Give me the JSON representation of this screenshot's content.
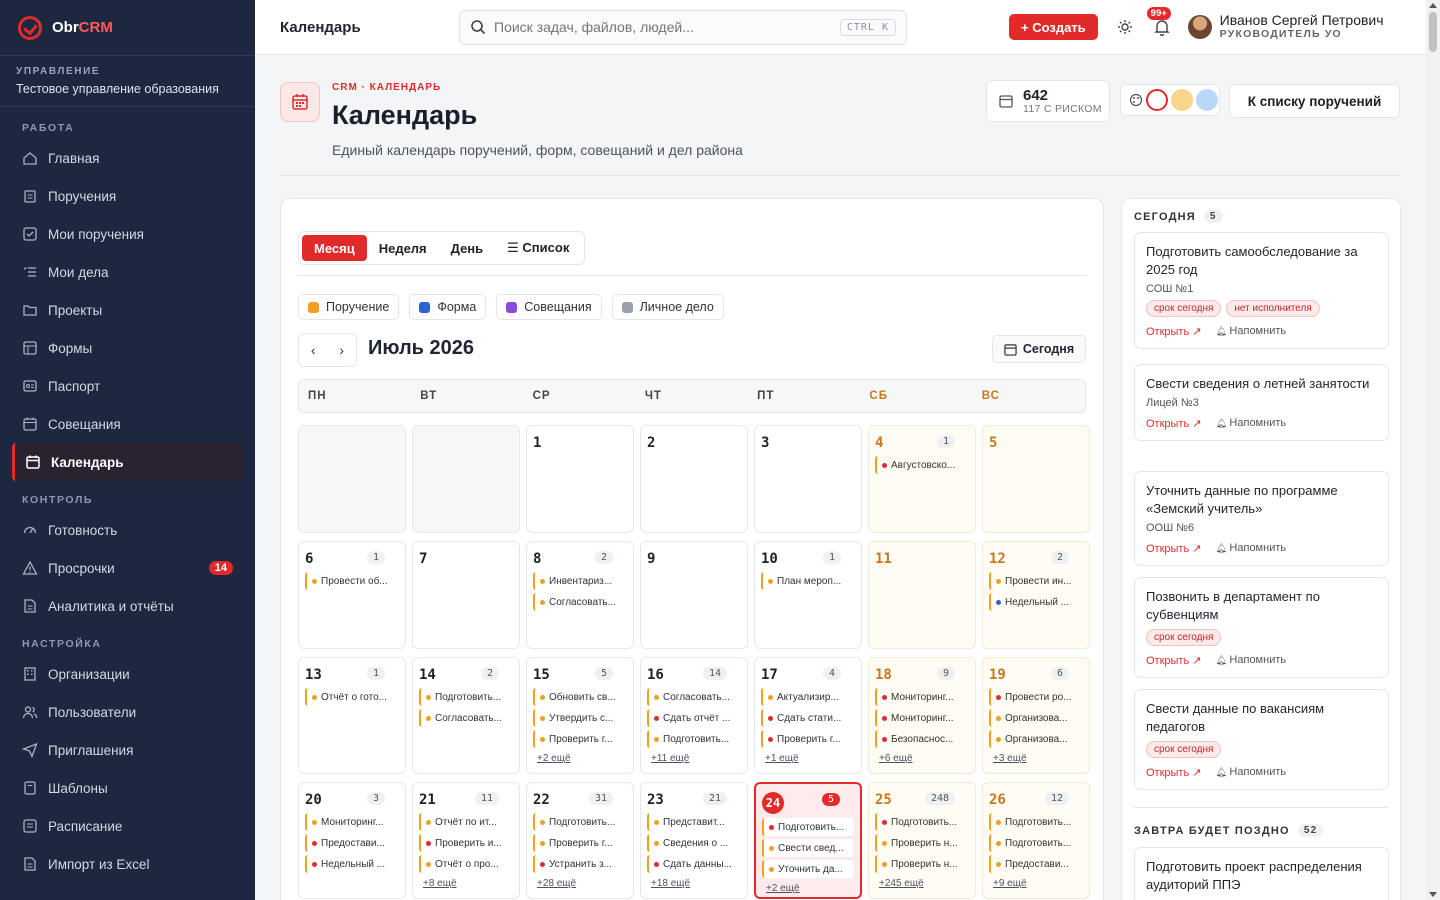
{
  "brand": {
    "name_a": "Obr",
    "name_b": "CRM"
  },
  "org": {
    "caption": "УПРАВЛЕНИЕ",
    "name": "Тестовое управление образования"
  },
  "sidebar": {
    "sections": [
      {
        "title": "РАБОТА",
        "items": [
          {
            "label": "Главная",
            "icon": "home-icon"
          },
          {
            "label": "Поручения",
            "icon": "clipboard-icon"
          },
          {
            "label": "Мои поручения",
            "icon": "check-square-icon"
          },
          {
            "label": "Мои дела",
            "icon": "list-check-icon"
          },
          {
            "label": "Проекты",
            "icon": "folder-icon"
          },
          {
            "label": "Формы",
            "icon": "form-icon"
          },
          {
            "label": "Паспорт",
            "icon": "id-card-icon"
          },
          {
            "label": "Совещания",
            "icon": "calendar-meeting-icon"
          },
          {
            "label": "Календарь",
            "icon": "calendar-icon",
            "active": true
          }
        ]
      },
      {
        "title": "КОНТРОЛЬ",
        "items": [
          {
            "label": "Готовность",
            "icon": "gauge-icon"
          },
          {
            "label": "Просрочки",
            "icon": "warning-icon",
            "badge": "14"
          },
          {
            "label": "Аналитика и отчёты",
            "icon": "report-icon"
          }
        ]
      },
      {
        "title": "НАСТРОЙКА",
        "items": [
          {
            "label": "Организации",
            "icon": "building-icon"
          },
          {
            "label": "Пользователи",
            "icon": "users-icon"
          },
          {
            "label": "Приглашения",
            "icon": "send-icon"
          },
          {
            "label": "Шаблоны",
            "icon": "template-icon"
          },
          {
            "label": "Расписание",
            "icon": "clock-icon"
          },
          {
            "label": "Импорт из Excel",
            "icon": "file-icon"
          }
        ]
      }
    ]
  },
  "topbar": {
    "title": "Календарь",
    "search_placeholder": "Поиск задач, файлов, людей...",
    "search_kbd": "CTRL K",
    "create_label": "+ Создать",
    "notif_badge": "99+",
    "user_name": "Иванов Сергей Петрович",
    "user_role": "РУКОВОДИТЕЛЬ УО"
  },
  "header": {
    "crumb": "CRM · КАЛЕНДАРЬ",
    "title": "Календарь",
    "subtitle": "Единый календарь поручений, форм, совещаний и дел района",
    "stat_value": "642",
    "stat_sub": "117 С РИСКОМ",
    "back_label": "К списку поручений",
    "theme_colors": [
      "#ffffff",
      "#f9d48b",
      "#b9d7f7"
    ]
  },
  "calendar": {
    "views": [
      "Месяц",
      "Неделя",
      "День",
      "☰ Список"
    ],
    "legend": [
      {
        "label": "Поручение",
        "color": "#f0a020"
      },
      {
        "label": "Форма",
        "color": "#2b62d9"
      },
      {
        "label": "Совещания",
        "color": "#8b4ae0"
      },
      {
        "label": "Личное дело",
        "color": "#9aa0aa"
      }
    ],
    "month_label": "Июль 2026",
    "today_label": "Сегодня",
    "weekdays": [
      "ПН",
      "ВТ",
      "СР",
      "ЧТ",
      "ПТ",
      "СБ",
      "ВС"
    ],
    "weeks": [
      [
        {
          "empty": true
        },
        {
          "empty": true
        },
        {
          "day": "1",
          "events": []
        },
        {
          "day": "2",
          "events": []
        },
        {
          "day": "3",
          "events": []
        },
        {
          "day": "4",
          "count": "1",
          "events": [
            {
              "t": "Августовско...",
              "c": "#e32a2a"
            }
          ]
        },
        {
          "day": "5",
          "events": []
        }
      ],
      [
        {
          "day": "6",
          "count": "1",
          "events": [
            {
              "t": "Провести об...",
              "c": "#f0a020"
            }
          ]
        },
        {
          "day": "7",
          "events": []
        },
        {
          "day": "8",
          "count": "2",
          "events": [
            {
              "t": "Инвентариз...",
              "c": "#f0a020"
            },
            {
              "t": "Согласовать...",
              "c": "#f0a020"
            }
          ]
        },
        {
          "day": "9",
          "events": []
        },
        {
          "day": "10",
          "count": "1",
          "events": [
            {
              "t": "План мероп...",
              "c": "#f0a020"
            }
          ]
        },
        {
          "day": "11",
          "events": []
        },
        {
          "day": "12",
          "count": "2",
          "events": [
            {
              "t": "Провести ин...",
              "c": "#f0a020"
            },
            {
              "t": "Недельный ...",
              "c": "#2b62d9"
            }
          ]
        }
      ],
      [
        {
          "day": "13",
          "count": "1",
          "events": [
            {
              "t": "Отчёт о гото...",
              "c": "#f0a020"
            }
          ]
        },
        {
          "day": "14",
          "count": "2",
          "events": [
            {
              "t": "Подготовить...",
              "c": "#f0a020"
            },
            {
              "t": "Согласовать...",
              "c": "#f0a020"
            }
          ]
        },
        {
          "day": "15",
          "count": "5",
          "events": [
            {
              "t": "Обновить св...",
              "c": "#f0a020"
            },
            {
              "t": "Утвердить с...",
              "c": "#f0a020"
            },
            {
              "t": "Проверить г...",
              "c": "#f0a020"
            }
          ],
          "more": "+2 ещё"
        },
        {
          "day": "16",
          "count": "14",
          "events": [
            {
              "t": "Согласовать...",
              "c": "#f0a020"
            },
            {
              "t": "Сдать отчёт ...",
              "c": "#e32a2a"
            },
            {
              "t": "Подготовить...",
              "c": "#f0a020"
            }
          ],
          "more": "+11 ещё"
        },
        {
          "day": "17",
          "count": "4",
          "events": [
            {
              "t": "Актуализир...",
              "c": "#f0a020"
            },
            {
              "t": "Сдать стати...",
              "c": "#e32a2a"
            },
            {
              "t": "Проверить г...",
              "c": "#e32a2a"
            }
          ],
          "more": "+1 ещё"
        },
        {
          "day": "18",
          "count": "9",
          "events": [
            {
              "t": "Мониторинг...",
              "c": "#e32a2a"
            },
            {
              "t": "Мониторинг...",
              "c": "#e32a2a"
            },
            {
              "t": "Безопаснос...",
              "c": "#e32a2a"
            }
          ],
          "more": "+6 ещё"
        },
        {
          "day": "19",
          "count": "6",
          "events": [
            {
              "t": "Провести ро...",
              "c": "#e32a2a"
            },
            {
              "t": "Организова...",
              "c": "#f0a020"
            },
            {
              "t": "Организова...",
              "c": "#f0a020"
            }
          ],
          "more": "+3 ещё"
        }
      ],
      [
        {
          "day": "20",
          "count": "3",
          "events": [
            {
              "t": "Мониторинг...",
              "c": "#f0a020"
            },
            {
              "t": "Предостави...",
              "c": "#e32a2a"
            },
            {
              "t": "Недельный ...",
              "c": "#e32a2a"
            }
          ]
        },
        {
          "day": "21",
          "count": "11",
          "events": [
            {
              "t": "Отчёт по ит...",
              "c": "#f0a020"
            },
            {
              "t": "Проверить и...",
              "c": "#e32a2a"
            },
            {
              "t": "Отчёт о про...",
              "c": "#f0a020"
            }
          ],
          "more": "+8 ещё"
        },
        {
          "day": "22",
          "count": "31",
          "events": [
            {
              "t": "Подготовить...",
              "c": "#f0a020"
            },
            {
              "t": "Проверить г...",
              "c": "#f0a020"
            },
            {
              "t": "Устранить з...",
              "c": "#e32a2a"
            }
          ],
          "more": "+28 ещё"
        },
        {
          "day": "23",
          "count": "21",
          "events": [
            {
              "t": "Представит...",
              "c": "#f0a020"
            },
            {
              "t": "Сведения о ...",
              "c": "#f0a020"
            },
            {
              "t": "Сдать данны...",
              "c": "#e32a2a"
            }
          ],
          "more": "+18 ещё"
        },
        {
          "day": "24",
          "count": "5",
          "today": true,
          "events": [
            {
              "t": "Подготовить...",
              "c": "#e32a2a"
            },
            {
              "t": "Свести свед...",
              "c": "#f0a020"
            },
            {
              "t": "Уточнить да...",
              "c": "#f0a020"
            }
          ],
          "more": "+2 ещё"
        },
        {
          "day": "25",
          "count": "248",
          "events": [
            {
              "t": "Подготовить...",
              "c": "#e32a2a"
            },
            {
              "t": "Проверить н...",
              "c": "#f0a020"
            },
            {
              "t": "Проверить н...",
              "c": "#f0a020"
            }
          ],
          "more": "+245 ещё"
        },
        {
          "day": "26",
          "count": "12",
          "events": [
            {
              "t": "Подготовить...",
              "c": "#f0a020"
            },
            {
              "t": "Подготовить...",
              "c": "#f0a020"
            },
            {
              "t": "Предостави...",
              "c": "#f0a020"
            }
          ],
          "more": "+9 ещё"
        }
      ]
    ]
  },
  "panel": {
    "today_title": "СЕГОДНЯ",
    "today_count": "5",
    "open_label": "Открыть",
    "remind_label": "Напомнить",
    "cards": [
      {
        "title": "Подготовить самообследование за 2025 год",
        "org": "СОШ №1",
        "tags": [
          "срок сегодня",
          "нет исполнителя"
        ]
      },
      {
        "title": "Свести сведения о летней занятости",
        "org": "Лицей №3",
        "tags": []
      },
      {
        "title": "Уточнить данные по программе «Земский учитель»",
        "org": "ООШ №6",
        "tags": []
      },
      {
        "title": "Позвонить в департамент по субвенциям",
        "org": "",
        "tags": [
          "срок сегодня"
        ]
      },
      {
        "title": "Свести данные по вакансиям педагогов",
        "org": "",
        "tags": [
          "срок сегодня"
        ]
      }
    ],
    "tomorrow_title": "ЗАВТРА БУДЕТ ПОЗДНО",
    "tomorrow_count": "52",
    "tomorrow_card": "Подготовить проект распределения аудиторий ППЭ"
  }
}
